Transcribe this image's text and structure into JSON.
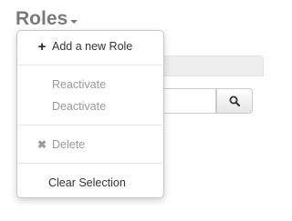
{
  "header": {
    "title": "Roles"
  },
  "search": {
    "button_icon": "search-icon"
  },
  "menu": {
    "add_role": "Add a new Role",
    "reactivate": "Reactivate",
    "deactivate": "Deactivate",
    "delete": "Delete",
    "clear_selection": "Clear Selection"
  },
  "icons": {
    "add": "plus-icon",
    "delete": "cross-icon",
    "title": "chevron-down-icon"
  }
}
